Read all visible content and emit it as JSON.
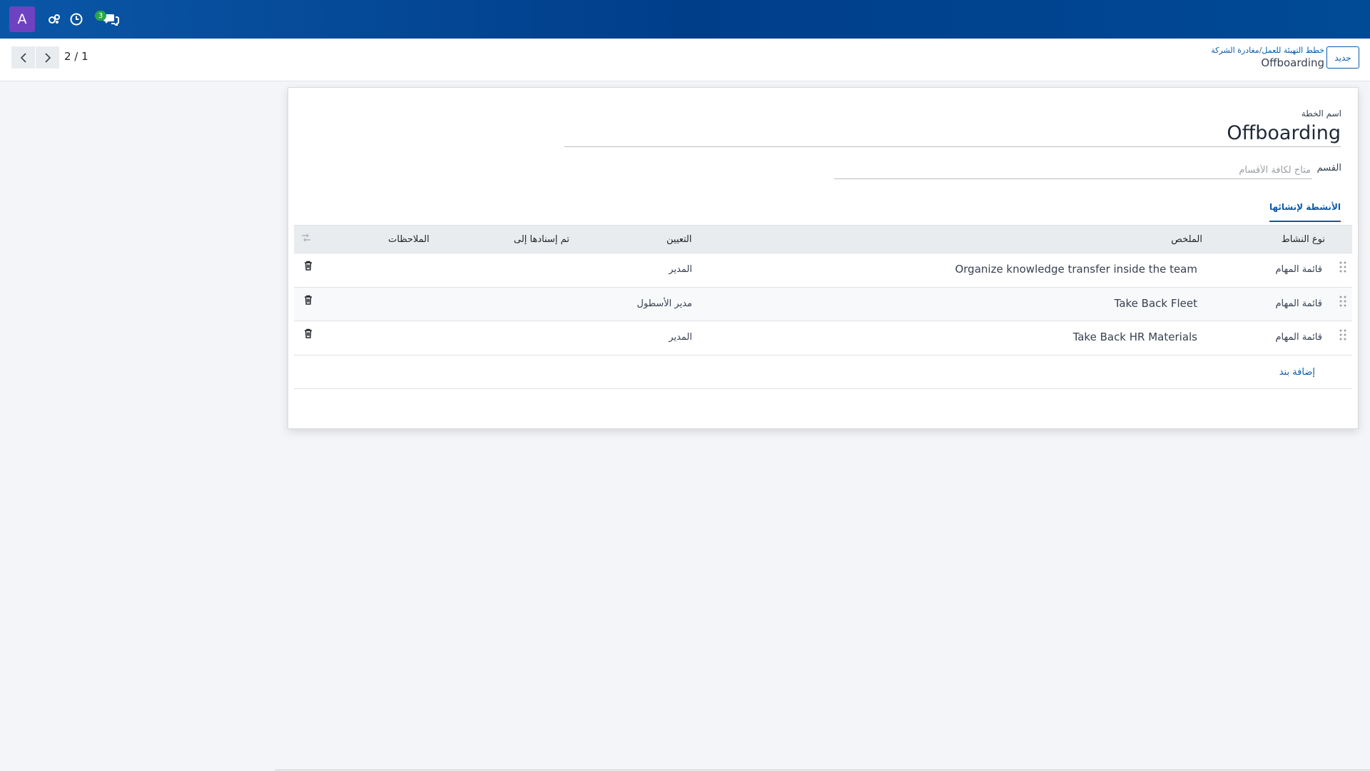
{
  "navbar": {
    "avatar_letter": "A",
    "icons": [
      "activity-icon",
      "clock-icon",
      "chat-icon"
    ],
    "chat_badge": "3",
    "background": "#0a56a6"
  },
  "control_panel": {
    "new_button": "جديد",
    "breadcrumb_parent": "خطط التهيئة للعمل",
    "breadcrumb_separator": "/",
    "breadcrumb_middle": "مغادرة الشركة",
    "breadcrumb_current": "Offboarding",
    "pager_value": "2 / 1"
  },
  "form": {
    "plan_label": "اسم الخطة",
    "plan_name": "Offboarding",
    "department_label": "القسم",
    "department_placeholder": "متاح لكافة الأقسام",
    "tab_label": "الأنشطة لإنشائها"
  },
  "table": {
    "headers": {
      "activity_type": "نوع النشاط",
      "summary": "الملخص",
      "assignment": "التعيين",
      "assigned_to": "تم إسنادها إلى",
      "notes": "الملاحظات"
    },
    "rows": [
      {
        "activity_type": "قائمة المهام",
        "summary": "Organize knowledge transfer inside the team",
        "assignment": "المدير",
        "assigned_to": "",
        "notes": ""
      },
      {
        "activity_type": "قائمة المهام",
        "summary": "Take Back Fleet",
        "assignment": "مدير الأسطول",
        "assigned_to": "",
        "notes": ""
      },
      {
        "activity_type": "قائمة المهام",
        "summary": "Take Back HR Materials",
        "assignment": "المدير",
        "assigned_to": "",
        "notes": ""
      }
    ],
    "add_line": "إضافة بند"
  },
  "colors": {
    "accent": "#0b5aa8",
    "avatar": "#6f42c1",
    "badge": "#28a745"
  }
}
